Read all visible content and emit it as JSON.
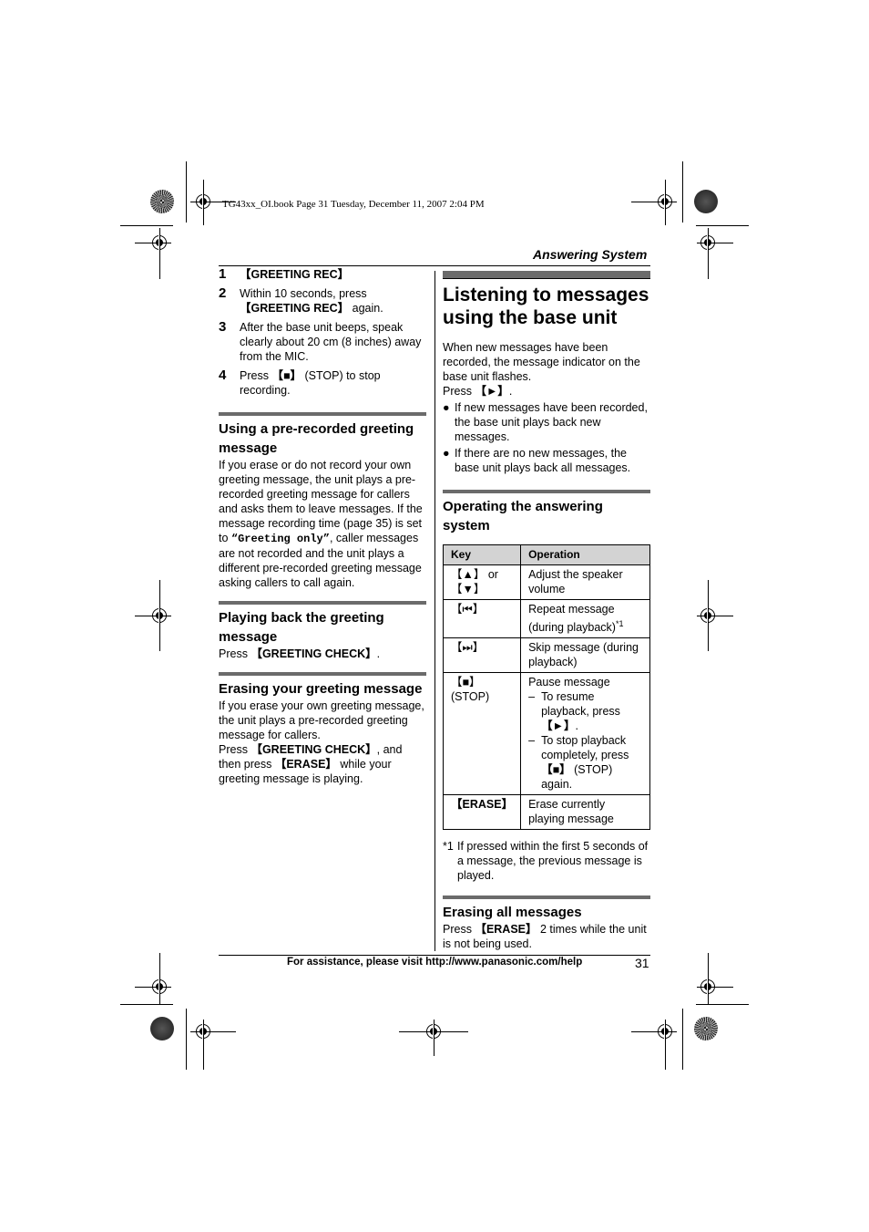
{
  "file_meta": "TG43xx_OI.book  Page 31  Tuesday, December 11, 2007  2:04 PM",
  "section_title": "Answering System",
  "left_column": {
    "steps": [
      {
        "num": "1",
        "parts": [
          {
            "t": "【GREETING REC】",
            "b": true
          }
        ]
      },
      {
        "num": "2",
        "parts": [
          {
            "t": "Within 10 seconds, press ",
            "b": false
          },
          {
            "t": "【GREETING REC】",
            "b": true
          },
          {
            "t": " again.",
            "b": false
          }
        ]
      },
      {
        "num": "3",
        "parts": [
          {
            "t": "After the base unit beeps, speak clearly about 20 cm (8 inches) away from the MIC.",
            "b": false
          }
        ]
      },
      {
        "num": "4",
        "parts": [
          {
            "t": "Press ",
            "b": false
          },
          {
            "t": "【■】",
            "b": true
          },
          {
            "t": " (STOP) to stop recording.",
            "b": false
          }
        ]
      }
    ],
    "prerecorded": {
      "heading": "Using a pre-recorded greeting message",
      "text_before": "If you erase or do not record your own greeting message, the unit plays a pre-recorded greeting message for callers and asks them to leave messages. If the message recording time (page 35) is set to ",
      "setting": "“Greeting only”",
      "text_after": ", caller messages are not recorded and the unit plays a different pre-recorded greeting message asking callers to call again."
    },
    "playback": {
      "heading": "Playing back the greeting message",
      "press": "Press ",
      "key": "【GREETING CHECK】",
      "end": "."
    },
    "erasing": {
      "heading": "Erasing your greeting message",
      "text": "If you erase your own greeting message, the unit plays a pre-recorded greeting message for callers.",
      "press": "Press ",
      "key1": "【GREETING CHECK】",
      "mid": ", and then press ",
      "key2": "【ERASE】",
      "end": " while your greeting message is playing."
    }
  },
  "right_column": {
    "title": "Listening to messages using the base unit",
    "intro": "When new messages have been recorded, the message indicator on the base unit flashes.",
    "press": "Press ",
    "press_key": "【►】",
    "press_end": ".",
    "bullets": [
      "If new messages have been recorded, the base unit plays back new messages.",
      "If there are no new messages, the base unit plays back all messages."
    ],
    "operating": {
      "heading": "Operating the answering system",
      "table": {
        "headers": [
          "Key",
          "Operation"
        ],
        "rows": [
          {
            "key": "【▲】 or 【▼】",
            "op": "Adjust the speaker volume"
          },
          {
            "key": "【⏮】",
            "op": "Repeat message (during playback)",
            "sup": "*1"
          },
          {
            "key": "【⏭】",
            "op": "Skip message (during playback)"
          },
          {
            "key": "【■】",
            "key_sub": "(STOP)",
            "op": "Pause message",
            "sub_items": [
              {
                "dash": "–",
                "before": "To resume playback, press ",
                "key": "【►】",
                "after": "."
              },
              {
                "dash": "–",
                "before": "To stop playback completely, press ",
                "key": "【■】",
                "after": " (STOP) again."
              }
            ]
          },
          {
            "key": "【ERASE】",
            "op": "Erase currently playing message"
          }
        ]
      }
    },
    "footnote": {
      "mark": "*1",
      "text": "If pressed within the first 5 seconds of a message, the previous message is played."
    },
    "erase_all": {
      "heading": "Erasing all messages",
      "press": "Press ",
      "key": "【ERASE】",
      "end": " 2 times while the unit is not being used."
    }
  },
  "footer": {
    "assistance": "For assistance, please visit http://www.panasonic.com/help",
    "page_number": "31"
  }
}
